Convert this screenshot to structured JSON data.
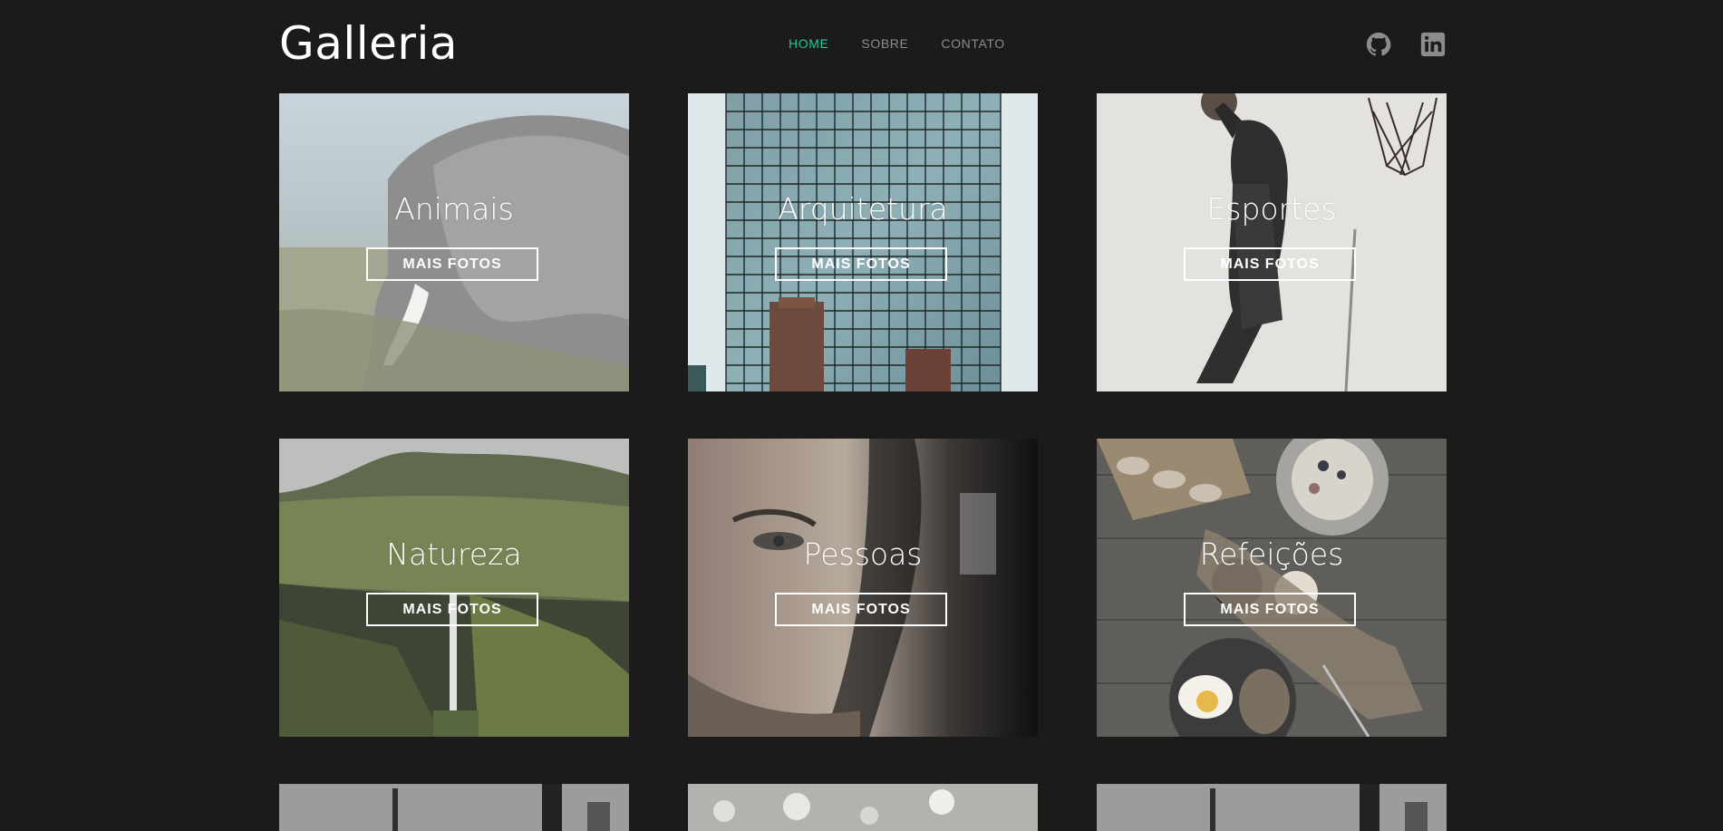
{
  "header": {
    "logo": "Galleria",
    "nav": [
      {
        "label": "HOME",
        "active": true
      },
      {
        "label": "SOBRE",
        "active": false
      },
      {
        "label": "CONTATO",
        "active": false
      }
    ],
    "social_icons": [
      "github-icon",
      "linkedin-icon"
    ]
  },
  "gallery": {
    "button_label": "MAIS FOTOS",
    "cards": [
      {
        "title": "Animais",
        "image": "elephant-photo"
      },
      {
        "title": "Arquitetura",
        "image": "glass-building-photo"
      },
      {
        "title": "Esportes",
        "image": "basketball-player-photo"
      },
      {
        "title": "Natureza",
        "image": "waterfall-cliff-photo"
      },
      {
        "title": "Pessoas",
        "image": "man-portrait-photo"
      },
      {
        "title": "Refeições",
        "image": "breakfast-table-photo"
      }
    ]
  },
  "colors": {
    "background": "#1b1b1b",
    "accent": "#1fc89a",
    "nav_text": "#8c8c8c",
    "text": "#ffffff"
  }
}
